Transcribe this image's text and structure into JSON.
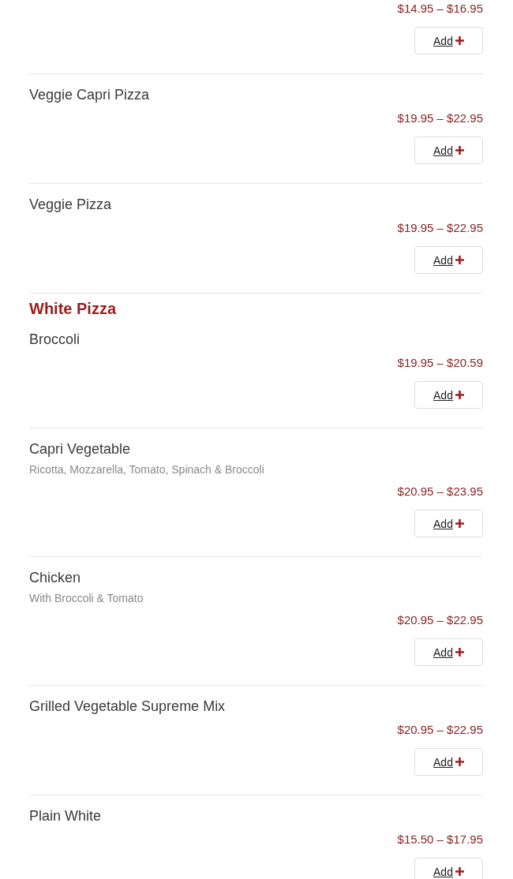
{
  "entries": [
    {
      "kind": "item",
      "price": "$14.95 – $16.95",
      "button": "Add"
    },
    {
      "kind": "item",
      "name": "Veggie Capri Pizza",
      "price": "$19.95 – $22.95",
      "button": "Add"
    },
    {
      "kind": "item",
      "name": "Veggie Pizza",
      "price": "$19.95 – $22.95",
      "button": "Add"
    },
    {
      "kind": "heading",
      "title": "White Pizza"
    },
    {
      "kind": "item",
      "name": "Broccoli",
      "price": "$19.95 – $20.59",
      "button": "Add"
    },
    {
      "kind": "item",
      "name": "Capri Vegetable",
      "description": "Ricotta, Mozzarella, Tomato, Spinach & Broccoli",
      "price": "$20.95 – $23.95",
      "button": "Add"
    },
    {
      "kind": "item",
      "name": "Chicken",
      "description": "With Broccoli & Tomato",
      "price": "$20.95 – $22.95",
      "button": "Add"
    },
    {
      "kind": "item",
      "name": "Grilled Vegetable Supreme Mix",
      "price": "$20.95 – $22.95",
      "button": "Add"
    },
    {
      "kind": "item",
      "name": "Plain White",
      "price": "$15.50 – $17.95",
      "button": "Add"
    }
  ]
}
